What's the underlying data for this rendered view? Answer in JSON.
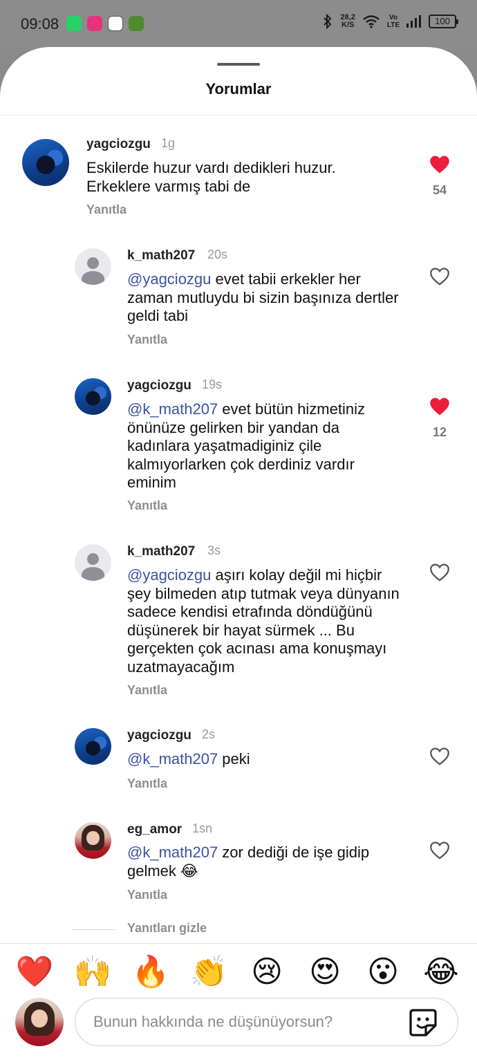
{
  "status_bar": {
    "time": "09:08",
    "speed": "28,2",
    "speed_unit": "K/S",
    "volte_top": "Vo",
    "volte_bottom": "LTE",
    "battery": "100"
  },
  "sheet": {
    "title": "Yorumlar"
  },
  "comments": [
    {
      "user": "yagciozgu",
      "time": "1g",
      "mention": "",
      "text": "Eskilerde huzur vardı dedikleri huzur. Erkeklere varmış tabi de",
      "reply": "Yanıtla",
      "liked": true,
      "likes": "54",
      "avatar": "scuba"
    },
    {
      "user": "k_math207",
      "time": "20s",
      "mention": "@yagciozgu",
      "text": " evet tabii erkekler her zaman mutluydu bi sizin başınıza dertler geldi tabi",
      "reply": "Yanıtla",
      "liked": false,
      "likes": "",
      "avatar": "default"
    },
    {
      "user": "yagciozgu",
      "time": "19s",
      "mention": "@k_math207",
      "text": " evet bütün hizmetiniz önünüze gelirken bir yandan da kadınlara yaşatmadiginiz çile kalmıyorlarken çok derdiniz vardır eminim",
      "reply": "Yanıtla",
      "liked": true,
      "likes": "12",
      "avatar": "scuba"
    },
    {
      "user": "k_math207",
      "time": "3s",
      "mention": "@yagciozgu",
      "text": " aşırı kolay değil mi hiçbir şey bilmeden atıp tutmak veya dünyanın sadece kendisi etrafında döndüğünü düşünerek bir hayat sürmek ... Bu gerçekten çok acınası ama konuşmayı uzatmayacağım",
      "reply": "Yanıtla",
      "liked": false,
      "likes": "",
      "avatar": "default"
    },
    {
      "user": "yagciozgu",
      "time": "2s",
      "mention": "@k_math207",
      "text": " peki",
      "reply": "Yanıtla",
      "liked": false,
      "likes": "",
      "avatar": "scuba"
    },
    {
      "user": "eg_amor",
      "time": "1sn",
      "mention": "@k_math207",
      "text": " zor dediği de işe gidip gelmek 😂",
      "reply": "Yanıtla",
      "liked": false,
      "likes": "",
      "avatar": "girl"
    }
  ],
  "hide_replies": "Yanıtları gizle",
  "emoji_bar": [
    "❤️",
    "🙌",
    "🔥",
    "👏",
    "😢",
    "😍",
    "😮",
    "😂"
  ],
  "input": {
    "placeholder": "Bunun hakkında ne düşünüyorsun?"
  },
  "icons": {
    "heart_filled": "heart-filled-icon",
    "heart_outline": "heart-outline-icon",
    "sticker": "sticker-icon"
  },
  "colors": {
    "like_red": "#ed1c3a",
    "mention_blue": "#3b51a3"
  }
}
